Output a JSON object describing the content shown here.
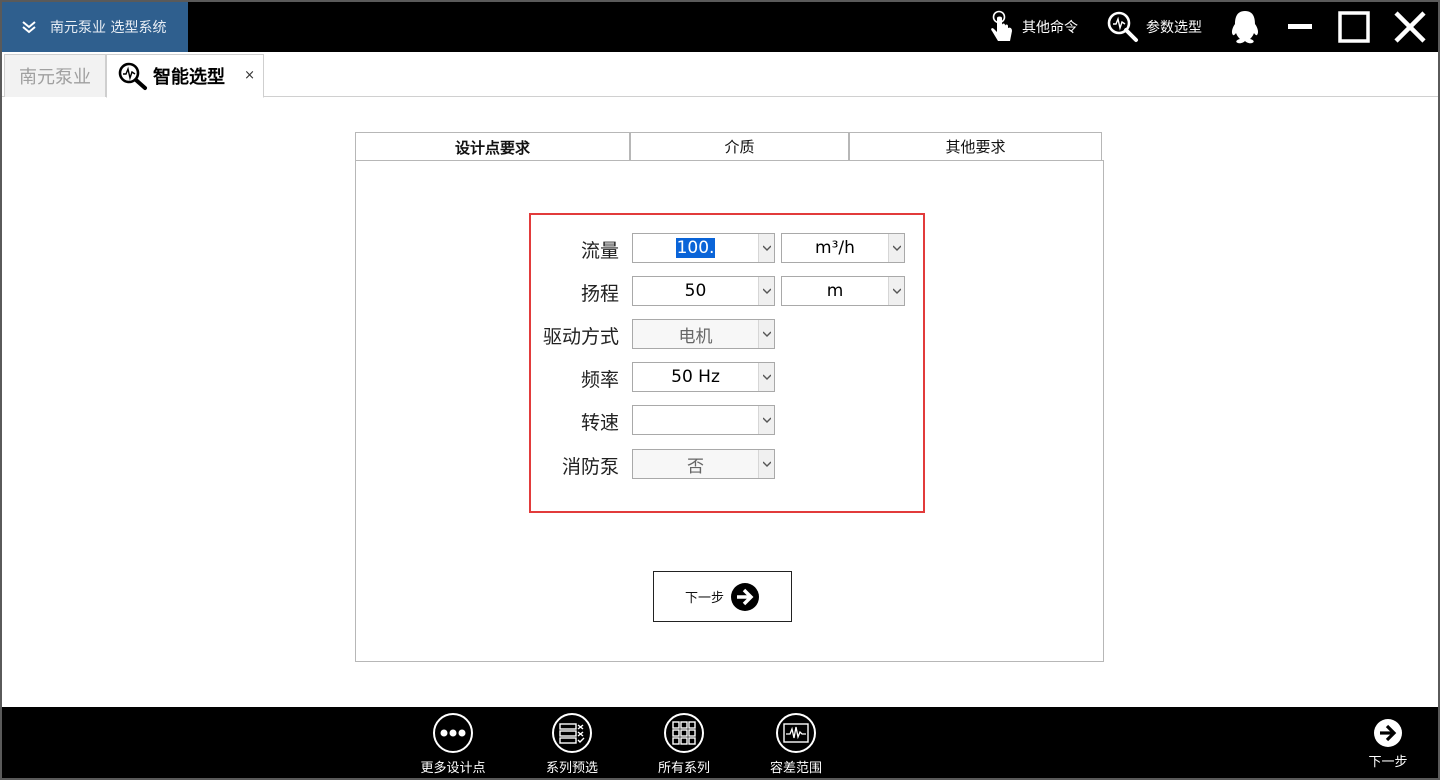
{
  "app": {
    "title": "南元泵业 选型系统"
  },
  "titlebar": {
    "other_commands": "其他命令",
    "param_select": "参数选型"
  },
  "tabs": {
    "home": "南元泵业",
    "smart": "智能选型",
    "close_glyph": "×"
  },
  "panel_tabs": [
    {
      "label": "设计点要求",
      "active": true
    },
    {
      "label": "介质",
      "active": false
    },
    {
      "label": "其他要求",
      "active": false
    }
  ],
  "form": {
    "flow": {
      "label": "流量",
      "value": "100.",
      "unit": "m³/h"
    },
    "head": {
      "label": "扬程",
      "value": "50",
      "unit": "m"
    },
    "drive": {
      "label": "驱动方式",
      "value": "电机"
    },
    "frequency": {
      "label": "频率",
      "value": "50 Hz"
    },
    "speed": {
      "label": "转速",
      "value": ""
    },
    "fire_pump": {
      "label": "消防泵",
      "value": "否"
    }
  },
  "next_button": {
    "label": "下一步"
  },
  "bottombar": {
    "more_points": "更多设计点",
    "series_preselect": "系列预选",
    "all_series": "所有系列",
    "tolerance_range": "容差范围",
    "next": "下一步"
  },
  "colors": {
    "title_bar": "#000000",
    "logo_bg": "#2f5f8e",
    "highlight_border": "#e23b3b",
    "selection": "#0a64d8"
  }
}
